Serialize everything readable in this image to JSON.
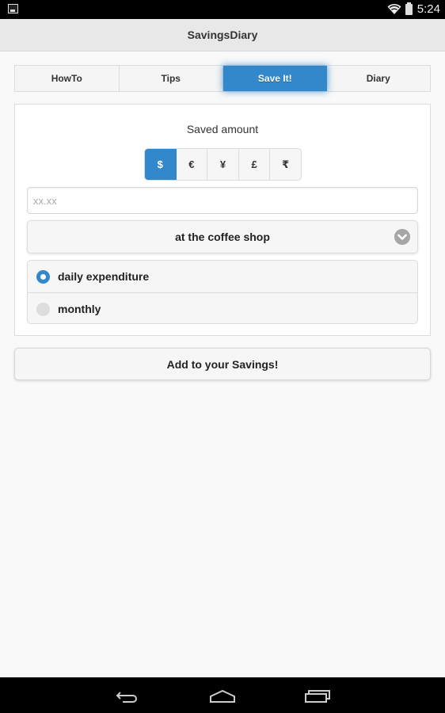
{
  "status_bar": {
    "time": "5:24",
    "icons": [
      "image-notification-icon",
      "wifi-icon",
      "battery-icon"
    ]
  },
  "app_bar": {
    "title": "SavingsDiary"
  },
  "tabs": [
    {
      "label": "HowTo",
      "active": false
    },
    {
      "label": "Tips",
      "active": false
    },
    {
      "label": "Save It!",
      "active": true
    },
    {
      "label": "Diary",
      "active": false
    }
  ],
  "form": {
    "title": "Saved amount",
    "currencies": [
      {
        "symbol": "$",
        "selected": true
      },
      {
        "symbol": "€",
        "selected": false
      },
      {
        "symbol": "¥",
        "selected": false
      },
      {
        "symbol": "£",
        "selected": false
      },
      {
        "symbol": "₹",
        "selected": false
      }
    ],
    "amount": {
      "value": "",
      "placeholder": "xx.xx"
    },
    "category_select": {
      "selected": "at the coffee shop",
      "icon": "chevron-down-icon"
    },
    "frequency": [
      {
        "label": "daily expenditure",
        "checked": true
      },
      {
        "label": "monthly",
        "checked": false
      }
    ]
  },
  "add_button": {
    "label": "Add to your Savings!"
  },
  "colors": {
    "accent": "#3388cc",
    "background": "#f9f9f9",
    "app_bar": "#e8e8e8"
  },
  "nav_bar": {
    "buttons": [
      "back-icon",
      "home-icon",
      "recents-icon"
    ]
  }
}
